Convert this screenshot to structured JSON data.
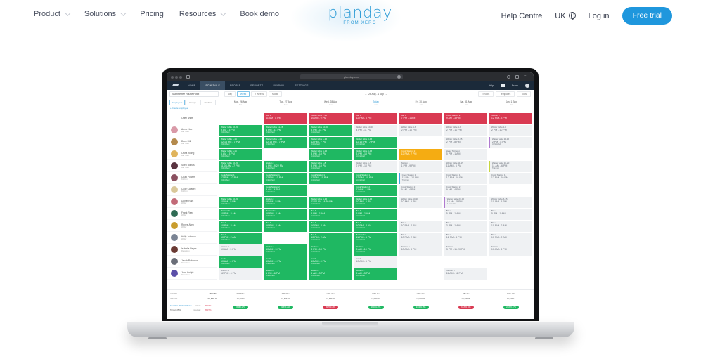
{
  "nav": {
    "items": [
      {
        "label": "Product",
        "dropdown": true
      },
      {
        "label": "Solutions",
        "dropdown": true
      },
      {
        "label": "Pricing",
        "dropdown": false
      },
      {
        "label": "Resources",
        "dropdown": true
      },
      {
        "label": "Book demo",
        "dropdown": false
      }
    ],
    "logo": {
      "wordmark": "planday",
      "sub": "FROM XERO"
    },
    "right": {
      "help": "Help Centre",
      "locale": "UK",
      "login": "Log in",
      "cta": "Free trial"
    }
  },
  "colors": {
    "brand": "#1f97dd",
    "shift_green": "#1fb862",
    "shift_red": "#d93a52",
    "shift_orange": "#f5ac12",
    "nav_dark": "#1b2a3a"
  },
  "app": {
    "browser_url": "planday.com",
    "tabs": [
      "HOME",
      "SCHEDULE",
      "PEOPLE",
      "REPORTS",
      "PAYROLL",
      "SETTINGS"
    ],
    "active_tab": "SCHEDULE",
    "top_right": {
      "help": "Help",
      "user": "Frank"
    },
    "toolbar": {
      "department": "Summerfee House Hotel",
      "views": [
        "Day",
        "Week",
        "2 Weeks",
        "Month"
      ],
      "active_view": "Week",
      "date_range": "26 Aug - 1 Sep",
      "right_dropdowns": [
        "Shows",
        "Templates",
        "Tools"
      ]
    },
    "left_tabs": [
      "Employees",
      "Groups",
      "Position"
    ],
    "create_employee": "+ Create employee",
    "open_shifts_label": "Open shifts",
    "days": [
      {
        "label": "Mon, 26 Aug",
        "today": false
      },
      {
        "label": "Tue, 27 Aug",
        "today": false
      },
      {
        "label": "Wed, 28 Aug",
        "today": false
      },
      {
        "label": "Today",
        "today": true
      },
      {
        "label": "Fri, 30 Aug",
        "today": false
      },
      {
        "label": "Sat, 31 Aug",
        "today": false
      },
      {
        "label": "Sun, 1 Sep",
        "today": false
      }
    ],
    "employees": [
      {
        "name": "Annie Noe",
        "sub": "Bar Team",
        "color": "#d99aa8"
      },
      {
        "name": "Drew Hill",
        "sub": "Bar Team",
        "color": "#b48a4d"
      },
      {
        "name": "Olivia Young",
        "sub": "Bar Team",
        "color": "#e0b45c"
      },
      {
        "name": "Sue Thomas",
        "sub": "Bar Team",
        "color": "#5a3340"
      },
      {
        "name": "Chad Powers",
        "sub": "Kitchen",
        "color": "#8a5060"
      },
      {
        "name": "Cody Cadwell",
        "sub": "Kitchen",
        "color": "#d9c89a"
      },
      {
        "name": "Daniel Ram",
        "sub": "Waiter",
        "color": "#c26a78"
      },
      {
        "name": "Frank Reed",
        "sub": "Waiter",
        "color": "#2f6b54"
      },
      {
        "name": "Renee Allen",
        "sub": "Waiter",
        "color": "#c99d2e"
      },
      {
        "name": "Holly Johnson",
        "sub": "Waiter",
        "color": "#7a8494"
      },
      {
        "name": "Isabella Reyes",
        "sub": "Reception",
        "color": "#6a3a34"
      },
      {
        "name": "Jacob Robinson",
        "sub": "Reception",
        "color": "#6a6e78"
      },
      {
        "name": "John Knight",
        "sub": "Reception",
        "color": "#5b4fa8"
      }
    ],
    "shifts": [
      {
        "day": 1,
        "row": 0,
        "type": "red",
        "title": "Bar 1",
        "time": "11 AM - 8 PM"
      },
      {
        "day": 2,
        "row": 0,
        "type": "red",
        "title": "Waiter table 7-15",
        "time": "10 AM - 9 PM"
      },
      {
        "day": 3,
        "row": 0,
        "type": "red",
        "title": "Bar 1",
        "time": "12 PM - 6 PM"
      },
      {
        "day": 4,
        "row": 0,
        "type": "red",
        "title": "Bar 2",
        "time": "7 PM - 1 AM"
      },
      {
        "day": 5,
        "row": 0,
        "type": "red",
        "title": "Cook Station 2",
        "time": "9 AM - 3 PM"
      },
      {
        "day": 6,
        "row": 0,
        "type": "red",
        "title": "Station 2",
        "time": "12 PM - 3 PM"
      },
      {
        "day": 0,
        "row": 1,
        "type": "green",
        "title": "Waiter table 10-20",
        "time": "9 AM - 5 PM",
        "meta": "Unfinished"
      },
      {
        "day": 1,
        "row": 1,
        "type": "green",
        "title": "Waiter table 11-15",
        "time": "4 PM - 11 PM",
        "meta": "Unfinished"
      },
      {
        "day": 2,
        "row": 1,
        "type": "green",
        "title": "Waiter table 10-20",
        "time": "4 PM - 11 PM",
        "meta": "Unfinished"
      },
      {
        "day": 3,
        "row": 1,
        "type": "grey",
        "title": "Waiter table 10-20",
        "time": "4 PM - 11 PM"
      },
      {
        "day": 4,
        "row": 1,
        "type": "grey",
        "title": "Waiter table 1-8",
        "time": "2 PM - 10 PM"
      },
      {
        "day": 5,
        "row": 1,
        "type": "grey",
        "title": "Waiter table 1-8",
        "time": "2 PM - 10 PM"
      },
      {
        "day": 6,
        "row": 1,
        "type": "grey",
        "title": "Waiter table 1-8",
        "time": "2 PM - 10 PM"
      },
      {
        "day": 0,
        "row": 2,
        "type": "green",
        "title": "Waiter table 1-15",
        "time": "12:15 PM - 7 PM",
        "meta": "Unfinished"
      },
      {
        "day": 1,
        "row": 2,
        "type": "green",
        "title": "Waiter table 1-15",
        "time": "12:15 PM - 7 PM",
        "meta": "Unfinished"
      },
      {
        "day": 2,
        "row": 2,
        "type": "green",
        "title": "Waiter table 1-15",
        "time": "12 PM - 7 PM",
        "meta": "Unfinished"
      },
      {
        "day": 3,
        "row": 2,
        "type": "green",
        "title": "Waiter table 6-15",
        "time": "12:15 PM - 7 PM",
        "meta": "Unfinished"
      },
      {
        "day": 5,
        "row": 2,
        "type": "grey",
        "title": "Waiter table 6-15",
        "time": "2 PM - 8 PM"
      },
      {
        "day": 6,
        "row": 2,
        "type": "grey",
        "bar": "l",
        "title": "Waiter table 11-15",
        "time": "2 PM - 8 PM",
        "meta": "Unfinished"
      },
      {
        "day": 0,
        "row": 3,
        "type": "green",
        "title": "Waiter table 6-15",
        "time": "6 AM - 3 PM",
        "meta": "Unfinished"
      },
      {
        "day": 2,
        "row": 3,
        "type": "green",
        "title": "Waiter table 6-15",
        "time": "3 PM - 10 PM",
        "meta": "Unfinished"
      },
      {
        "day": 3,
        "row": 3,
        "type": "green",
        "title": "Waiter table 6-15",
        "time": "3 PM - 10 PM",
        "meta": "Unfinished"
      },
      {
        "day": 4,
        "row": 3,
        "type": "orange",
        "title": "Cook Station 2",
        "time": "12 PM - 7 PM"
      },
      {
        "day": 5,
        "row": 3,
        "type": "grey",
        "title": "Head Tat Boot",
        "time": "5 PM - 1 AM"
      },
      {
        "day": 0,
        "row": 4,
        "type": "green",
        "title": "Waiter table 10-20",
        "time": "11:03 AM - 7 PM",
        "meta": "Unfinished"
      },
      {
        "day": 1,
        "row": 4,
        "type": "green",
        "title": "Station 1",
        "time": "1 PM - 9:22 PM",
        "meta": "Unfinished"
      },
      {
        "day": 2,
        "row": 4,
        "type": "green",
        "title": "Waiter table 1-8",
        "time": "3 PM - 10 PM",
        "meta": "Unfinished"
      },
      {
        "day": 3,
        "row": 4,
        "type": "grey",
        "title": "Waiter table 1-8",
        "time": "2 PM - 10 PM"
      },
      {
        "day": 4,
        "row": 4,
        "type": "grey",
        "title": "Station 1",
        "time": "1 PM - 9 PM"
      },
      {
        "day": 5,
        "row": 4,
        "type": "grey",
        "title": "Waiter table 11-15",
        "time": "11 AM - 6 PM"
      },
      {
        "day": 6,
        "row": 4,
        "type": "grey",
        "bar": "y",
        "title": "Waiter table 10-20",
        "time": "11 AM - 6 PM",
        "meta": "Training"
      },
      {
        "day": 0,
        "row": 5,
        "type": "green",
        "title": "Cook Station 1",
        "time": "12 PM - 10 PM",
        "meta": "Unfinished"
      },
      {
        "day": 1,
        "row": 5,
        "type": "green",
        "title": "Cook Station 1",
        "time": "12 PM - 10 PM",
        "meta": "Unfinished"
      },
      {
        "day": 2,
        "row": 5,
        "type": "green",
        "title": "Cook Station 1",
        "time": "12 PM - 10 PM",
        "meta": "Unfinished"
      },
      {
        "day": 3,
        "row": 5,
        "type": "green",
        "title": "Cook Station 1",
        "time": "12 PM - 10 PM",
        "meta": "Unfinished"
      },
      {
        "day": 4,
        "row": 5,
        "type": "grey",
        "bar": "b",
        "title": "Cook Station 1",
        "time": "12 PM - 10 PM",
        "meta": "Training"
      },
      {
        "day": 5,
        "row": 5,
        "type": "grey",
        "title": "Cook Station 1",
        "time": "12 PM - 10 PM"
      },
      {
        "day": 6,
        "row": 5,
        "type": "grey",
        "title": "Cook Station 1",
        "time": "12 PM - 10 PM"
      },
      {
        "day": 1,
        "row": 6,
        "type": "green",
        "title": "Cook Station 2",
        "time": "9 AM - 4 PM",
        "meta": "Unfinished"
      },
      {
        "day": 3,
        "row": 6,
        "type": "green",
        "title": "Cook Station 2",
        "time": "11 AM - 4 PM",
        "meta": "Unfinished"
      },
      {
        "day": 4,
        "row": 6,
        "type": "grey",
        "title": "Cook Station 2",
        "time": "9 AM - 4 PM"
      },
      {
        "day": 5,
        "row": 6,
        "type": "grey",
        "title": "Cook Station 2",
        "time": "9 AM - 4 PM"
      },
      {
        "day": 0,
        "row": 7,
        "type": "green",
        "title": "Waiter table 10-20",
        "time": "10 AM - 5 PM",
        "meta": "Unfinished"
      },
      {
        "day": 1,
        "row": 7,
        "type": "green",
        "title": "Station 1",
        "time": "10 AM - 5 PM",
        "meta": "Unfinished"
      },
      {
        "day": 2,
        "row": 7,
        "type": "green",
        "title": "Waiter table 6-15",
        "time": "11:04 AM - 4:30 PM",
        "meta": "Unfinished"
      },
      {
        "day": 3,
        "row": 7,
        "type": "green",
        "title": "Waiter table 6-15",
        "time": "10 AM - 5 PM",
        "meta": "Unfinished"
      },
      {
        "day": 4,
        "row": 7,
        "type": "grey",
        "title": "Waiter table 10-20",
        "time": "10 AM - 5 PM"
      },
      {
        "day": 5,
        "row": 7,
        "type": "grey",
        "bar": "l",
        "title": "Waiter table 21-30",
        "time": "10 AM - 5 PM",
        "meta": "1 hour late"
      },
      {
        "day": 6,
        "row": 7,
        "type": "grey",
        "title": "Waiter table 6-15",
        "time": "10 AM - 5 PM"
      },
      {
        "day": 0,
        "row": 8,
        "type": "green",
        "title": "Bartender",
        "time": "10 PM - 2 AM",
        "meta": "Unfinished"
      },
      {
        "day": 1,
        "row": 8,
        "type": "green",
        "title": "Bartender",
        "time": "10 PM - 2 AM",
        "meta": "Unfinished"
      },
      {
        "day": 2,
        "row": 8,
        "type": "green",
        "title": "Bar 1",
        "time": "5 PM - 1 AM",
        "meta": "Unfinished"
      },
      {
        "day": 3,
        "row": 8,
        "type": "green",
        "title": "Bar 1",
        "time": "5 PM - 1 AM",
        "meta": "Unfinished"
      },
      {
        "day": 5,
        "row": 8,
        "type": "grey",
        "title": "Bar 2",
        "time": "5 PM - 1 AM"
      },
      {
        "day": 6,
        "row": 8,
        "type": "grey",
        "title": "Bar 1",
        "time": "5 PM - 1 AM"
      },
      {
        "day": 0,
        "row": 9,
        "type": "green",
        "title": "Bar 1",
        "time": "10 PM - 2 AM",
        "meta": "Unfinished"
      },
      {
        "day": 1,
        "row": 9,
        "type": "green",
        "title": "Bar 1",
        "time": "10 PM - 2 AM",
        "meta": "Unfinished"
      },
      {
        "day": 2,
        "row": 9,
        "type": "green",
        "title": "Bar 1",
        "time": "10 PM - 2 AM",
        "meta": "Unfinished"
      },
      {
        "day": 3,
        "row": 9,
        "type": "green",
        "title": "Bar 1",
        "time": "10 PM - 2 AM",
        "meta": "Unfinished"
      },
      {
        "day": 4,
        "row": 9,
        "type": "grey",
        "title": "Bar 2",
        "time": "10 PM - 2 AM"
      },
      {
        "day": 5,
        "row": 9,
        "type": "grey",
        "title": "Bar 1",
        "time": "3 PM - 1 AM"
      },
      {
        "day": 6,
        "row": 9,
        "type": "grey",
        "title": "Bar 2",
        "time": "10 PM - 2 AM"
      },
      {
        "day": 0,
        "row": 10,
        "type": "green",
        "title": "Bar 1",
        "time": "10 PM - 2 AM",
        "meta": "Unfinished"
      },
      {
        "day": 2,
        "row": 10,
        "type": "green",
        "title": "Bar 1",
        "time": "10 PM - 2 AM",
        "meta": "Unfinished"
      },
      {
        "day": 3,
        "row": 10,
        "type": "green",
        "title": "Bartender",
        "time": "11 PM - 4 PM",
        "meta": "Unfinished"
      },
      {
        "day": 4,
        "row": 10,
        "type": "grey",
        "title": "Bar 1",
        "time": "10 PM - 2 AM"
      },
      {
        "day": 5,
        "row": 10,
        "type": "grey",
        "title": "Bar 3",
        "time": "12 PM - 6 PM"
      },
      {
        "day": 6,
        "row": 10,
        "type": "grey",
        "title": "Bar 3",
        "time": "10 PM - 2 AM"
      },
      {
        "day": 0,
        "row": 11,
        "type": "grey",
        "title": "Station 1",
        "time": "10 AM - 3 PM"
      },
      {
        "day": 1,
        "row": 11,
        "type": "green",
        "title": "Station 1",
        "time": "10 AM - 3 PM",
        "meta": "Unfinished"
      },
      {
        "day": 2,
        "row": 11,
        "type": "green",
        "title": "Station 1",
        "time": "3 PM - 10 PM",
        "meta": "Unfinished"
      },
      {
        "day": 3,
        "row": 11,
        "type": "green",
        "title": "Station 1",
        "time": "3 AM - 10 PM",
        "meta": "Unfinished"
      },
      {
        "day": 4,
        "row": 11,
        "type": "grey",
        "title": "Station 2",
        "time": "10 AM - 3 PM"
      },
      {
        "day": 5,
        "row": 11,
        "type": "grey",
        "title": "Station 1",
        "time": "3 PM - 11:20 PM"
      },
      {
        "day": 6,
        "row": 11,
        "type": "grey",
        "title": "Station 1",
        "time": "10 AM - 3 PM"
      },
      {
        "day": 0,
        "row": 12,
        "type": "green",
        "title": "Cook",
        "time": "10 AM - 4 PM",
        "meta": "Unfinished"
      },
      {
        "day": 1,
        "row": 12,
        "type": "green",
        "title": "Cook",
        "time": "10 AM - 4 PM",
        "meta": "Unfinished"
      },
      {
        "day": 2,
        "row": 12,
        "type": "green",
        "title": "Cook",
        "time": "10 AM - 4 PM",
        "meta": "Unfinished"
      },
      {
        "day": 3,
        "row": 12,
        "type": "grey",
        "title": "Cook",
        "time": "10 AM - 4 PM"
      },
      {
        "day": 0,
        "row": 13,
        "type": "grey",
        "title": "Station 2",
        "time": "12 PM - 6 PM"
      },
      {
        "day": 1,
        "row": 13,
        "type": "green",
        "title": "Station 2",
        "time": "1 PM - 6 PM",
        "meta": "Unfinished"
      },
      {
        "day": 2,
        "row": 13,
        "type": "green",
        "title": "Station 4",
        "time": "6 AM - 3 PM",
        "meta": "Unfinished"
      },
      {
        "day": 3,
        "row": 13,
        "type": "green",
        "title": "Station 4",
        "time": "6 AM - 3 PM",
        "meta": "Unfinished"
      },
      {
        "day": 5,
        "row": 13,
        "type": "grey",
        "title": "Station 4",
        "time": "11 AM - 11 PM"
      }
    ],
    "footer": {
      "row1_label": "HOURS",
      "row1_total": "755h 8m",
      "row2_label": "WAGES",
      "row2_total": "£26,879.15",
      "salary_label": "SALARY PERCENTAGE",
      "target_label": "Target: 25%",
      "actual_label": "Actual:",
      "actual_value": "26.37%",
      "forecast_label": "Forecast:",
      "forecast_value": "26.37%",
      "days": [
        {
          "hours": "98h 53m",
          "wages": "£3,393.0",
          "pct": "23.46% 27%",
          "ok": true
        },
        {
          "hours": "98h 30m",
          "wages": "£3,835.61",
          "pct": "22.57% 29%",
          "ok": true
        },
        {
          "hours": "118h 40m",
          "wages": "£3,555.41",
          "pct": "31.78% 28%",
          "ok": false
        },
        {
          "hours": "118h 4m",
          "wages": "£3,836.21",
          "pct": "23.46% 27%",
          "ok": true
        },
        {
          "hours": "120h 35m",
          "wages": "£3,903.08",
          "pct": "24.46% 25%",
          "ok": true
        },
        {
          "hours": "98h 3m",
          "wages": "£3,305.05",
          "pct": "31.29% 29%",
          "ok": false
        },
        {
          "hours": "101h 17m",
          "wages": "£3,636.12",
          "pct": "23.82% 27%",
          "ok": true
        }
      ]
    }
  }
}
